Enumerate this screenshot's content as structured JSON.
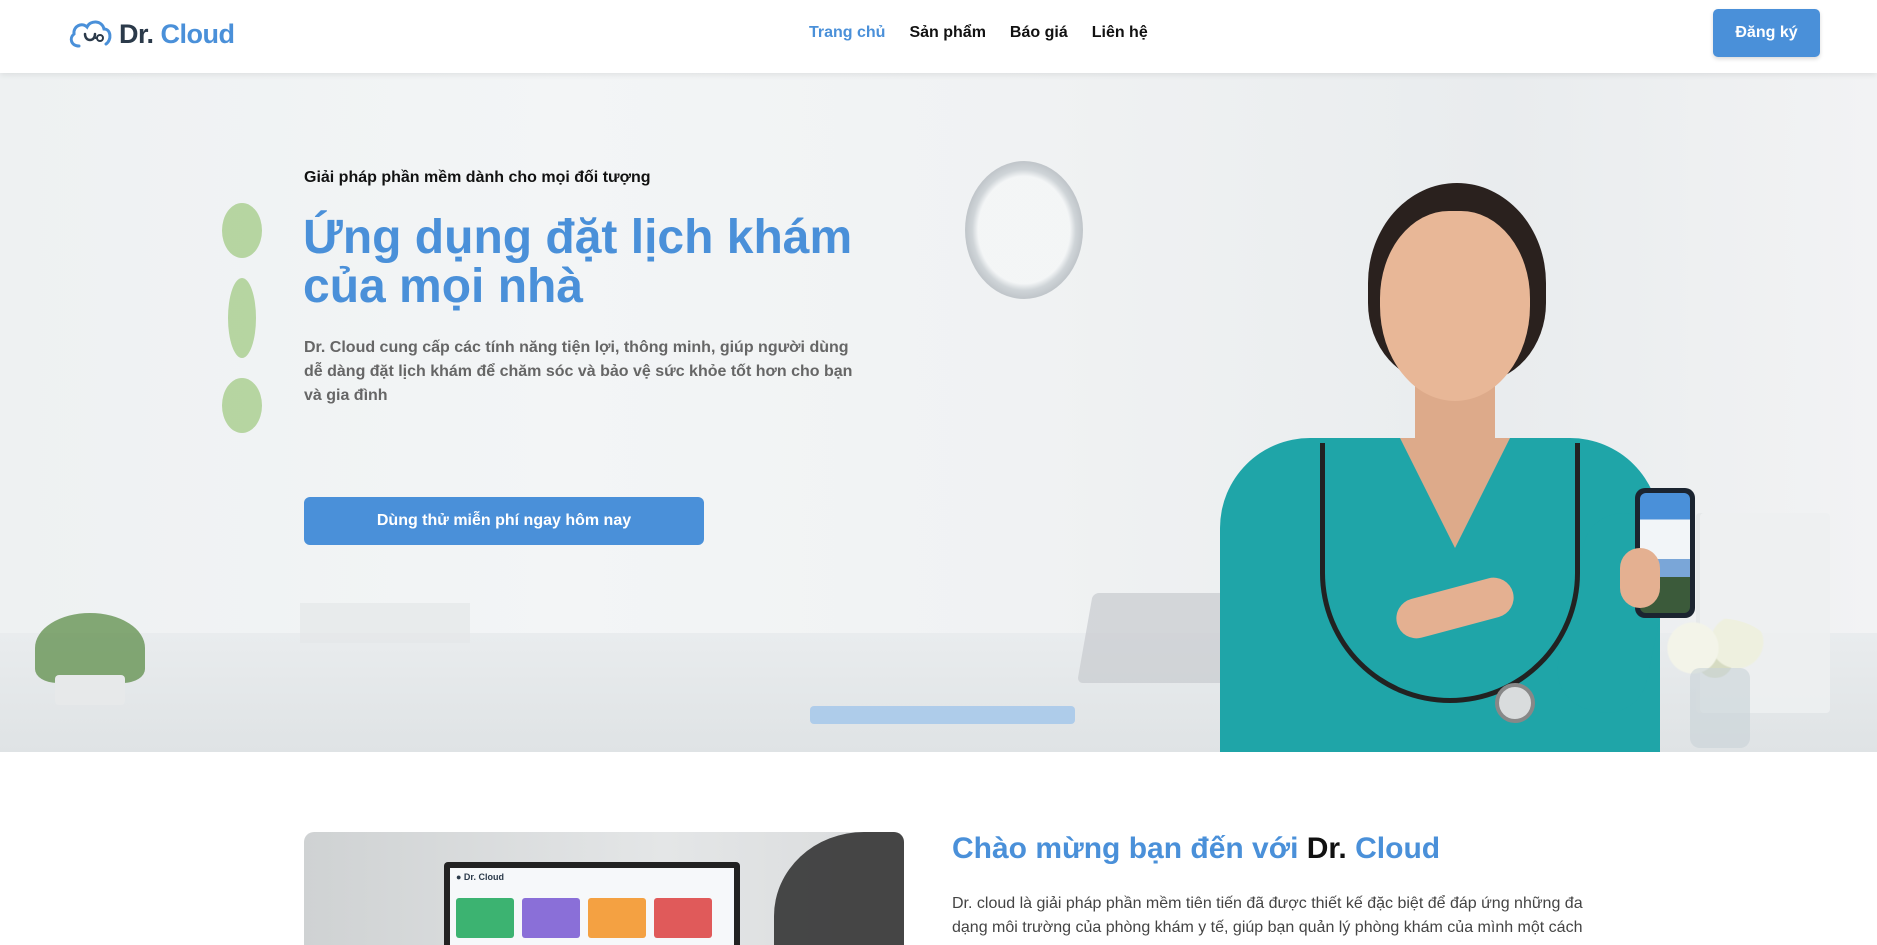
{
  "header": {
    "logo": {
      "dr": "Dr.",
      "cloud": "Cloud"
    },
    "nav": [
      {
        "label": "Trang chủ",
        "active": true
      },
      {
        "label": "Sản phẩm",
        "active": false
      },
      {
        "label": "Báo giá",
        "active": false
      },
      {
        "label": "Liên hệ",
        "active": false
      }
    ],
    "signup_label": "Đăng ký"
  },
  "hero": {
    "eyebrow": "Giải pháp phần mềm dành cho mọi đối tượng",
    "title": "Ứng dụng đặt lịch khám của mọi nhà",
    "description": "Dr. Cloud cung cấp các tính năng tiện lợi, thông minh, giúp người dùng dễ dàng đặt lịch khám để chăm sóc và bảo vệ sức khỏe tốt hơn cho bạn và gia đình",
    "cta_label": "Dùng thử miễn phí ngay hôm nay"
  },
  "welcome": {
    "title_prefix": "Chào mừng bạn đến với",
    "title_dr": "Dr.",
    "title_cloud": "Cloud",
    "text": "Dr. cloud là giải pháp phần mềm tiên tiến đã được thiết kế đặc biệt để đáp ứng những đa dạng môi trường của phòng khám y tế, giúp bạn quản lý phòng khám của mình một cách"
  },
  "colors": {
    "accent": "#4a90d9",
    "text_dark": "#111111",
    "text_muted": "#666666",
    "scrubs": "#1fa5a8"
  }
}
